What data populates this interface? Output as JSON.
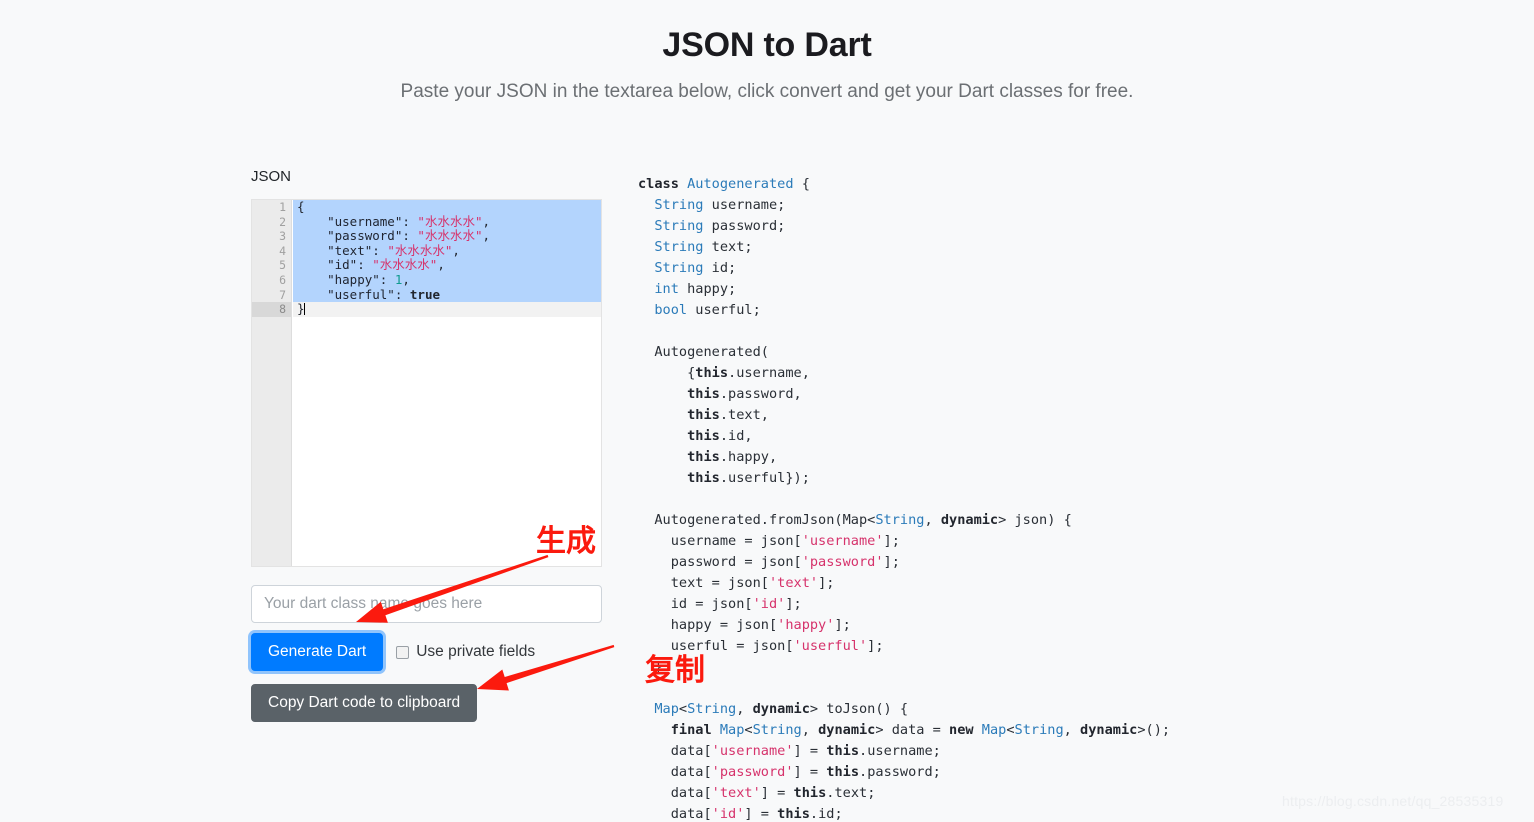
{
  "header": {
    "title": "JSON to Dart",
    "subtitle": "Paste your JSON in the textarea below, click convert and get your Dart classes for free."
  },
  "editor": {
    "label": "JSON",
    "line_numbers": [
      "1",
      "2",
      "3",
      "4",
      "5",
      "6",
      "7",
      "8"
    ],
    "fold_glyph": "▾",
    "active_line": 8,
    "lines": [
      {
        "n": 1,
        "selected": true,
        "tokens": [
          {
            "t": "punc",
            "v": "{"
          }
        ]
      },
      {
        "n": 2,
        "selected": true,
        "tokens": [
          {
            "t": "key",
            "v": "    \"username\": "
          },
          {
            "t": "str",
            "v": "\"水水水水\""
          },
          {
            "t": "punc",
            "v": ","
          }
        ]
      },
      {
        "n": 3,
        "selected": true,
        "tokens": [
          {
            "t": "key",
            "v": "    \"password\": "
          },
          {
            "t": "str",
            "v": "\"水水水水\""
          },
          {
            "t": "punc",
            "v": ","
          }
        ]
      },
      {
        "n": 4,
        "selected": true,
        "tokens": [
          {
            "t": "key",
            "v": "    \"text\": "
          },
          {
            "t": "str",
            "v": "\"水水水水\""
          },
          {
            "t": "punc",
            "v": ","
          }
        ]
      },
      {
        "n": 5,
        "selected": true,
        "tokens": [
          {
            "t": "key",
            "v": "    \"id\": "
          },
          {
            "t": "str",
            "v": "\"水水水水\""
          },
          {
            "t": "punc",
            "v": ","
          }
        ]
      },
      {
        "n": 6,
        "selected": true,
        "tokens": [
          {
            "t": "key",
            "v": "    \"happy\": "
          },
          {
            "t": "num",
            "v": "1"
          },
          {
            "t": "punc",
            "v": ","
          }
        ]
      },
      {
        "n": 7,
        "selected": true,
        "tokens": [
          {
            "t": "key",
            "v": "    \"userful\": "
          },
          {
            "t": "bool",
            "v": "true"
          }
        ]
      },
      {
        "n": 8,
        "selected": false,
        "current": true,
        "tokens": [
          {
            "t": "punc",
            "v": "}"
          }
        ]
      }
    ]
  },
  "form": {
    "class_name_value": "",
    "class_name_placeholder": "Your dart class name goes here",
    "generate_label": "Generate Dart",
    "private_fields_label": "Use private fields",
    "private_fields_checked": false,
    "copy_label": "Copy Dart code to clipboard"
  },
  "dart_output": {
    "lines": [
      [
        {
          "t": "kw",
          "v": "class "
        },
        {
          "t": "plain",
          "v": ""
        },
        {
          "t": "type",
          "v": "Autogenerated"
        },
        {
          "t": "plain",
          "v": " {"
        }
      ],
      [
        {
          "t": "type",
          "v": "  String"
        },
        {
          "t": "plain",
          "v": " username;"
        }
      ],
      [
        {
          "t": "type",
          "v": "  String"
        },
        {
          "t": "plain",
          "v": " password;"
        }
      ],
      [
        {
          "t": "type",
          "v": "  String"
        },
        {
          "t": "plain",
          "v": " text;"
        }
      ],
      [
        {
          "t": "type",
          "v": "  String"
        },
        {
          "t": "plain",
          "v": " id;"
        }
      ],
      [
        {
          "t": "type",
          "v": "  int"
        },
        {
          "t": "plain",
          "v": " happy;"
        }
      ],
      [
        {
          "t": "type",
          "v": "  bool"
        },
        {
          "t": "plain",
          "v": " userful;"
        }
      ],
      [
        {
          "t": "plain",
          "v": ""
        }
      ],
      [
        {
          "t": "plain",
          "v": "  Autogenerated("
        }
      ],
      [
        {
          "t": "plain",
          "v": "      {"
        },
        {
          "t": "kw",
          "v": "this"
        },
        {
          "t": "plain",
          "v": ".username,"
        }
      ],
      [
        {
          "t": "plain",
          "v": "      "
        },
        {
          "t": "kw",
          "v": "this"
        },
        {
          "t": "plain",
          "v": ".password,"
        }
      ],
      [
        {
          "t": "plain",
          "v": "      "
        },
        {
          "t": "kw",
          "v": "this"
        },
        {
          "t": "plain",
          "v": ".text,"
        }
      ],
      [
        {
          "t": "plain",
          "v": "      "
        },
        {
          "t": "kw",
          "v": "this"
        },
        {
          "t": "plain",
          "v": ".id,"
        }
      ],
      [
        {
          "t": "plain",
          "v": "      "
        },
        {
          "t": "kw",
          "v": "this"
        },
        {
          "t": "plain",
          "v": ".happy,"
        }
      ],
      [
        {
          "t": "plain",
          "v": "      "
        },
        {
          "t": "kw",
          "v": "this"
        },
        {
          "t": "plain",
          "v": ".userful});"
        }
      ],
      [
        {
          "t": "plain",
          "v": ""
        }
      ],
      [
        {
          "t": "plain",
          "v": "  Autogenerated.fromJson(Map<"
        },
        {
          "t": "type",
          "v": "String"
        },
        {
          "t": "plain",
          "v": ", "
        },
        {
          "t": "kw",
          "v": "dynamic"
        },
        {
          "t": "plain",
          "v": "> json) {"
        }
      ],
      [
        {
          "t": "plain",
          "v": "    username = json["
        },
        {
          "t": "str",
          "v": "'username'"
        },
        {
          "t": "plain",
          "v": "];"
        }
      ],
      [
        {
          "t": "plain",
          "v": "    password = json["
        },
        {
          "t": "str",
          "v": "'password'"
        },
        {
          "t": "plain",
          "v": "];"
        }
      ],
      [
        {
          "t": "plain",
          "v": "    text = json["
        },
        {
          "t": "str",
          "v": "'text'"
        },
        {
          "t": "plain",
          "v": "];"
        }
      ],
      [
        {
          "t": "plain",
          "v": "    id = json["
        },
        {
          "t": "str",
          "v": "'id'"
        },
        {
          "t": "plain",
          "v": "];"
        }
      ],
      [
        {
          "t": "plain",
          "v": "    happy = json["
        },
        {
          "t": "str",
          "v": "'happy'"
        },
        {
          "t": "plain",
          "v": "];"
        }
      ],
      [
        {
          "t": "plain",
          "v": "    userful = json["
        },
        {
          "t": "str",
          "v": "'userful'"
        },
        {
          "t": "plain",
          "v": "];"
        }
      ],
      [
        {
          "t": "plain",
          "v": "  }"
        }
      ],
      [
        {
          "t": "plain",
          "v": ""
        }
      ],
      [
        {
          "t": "type",
          "v": "  Map"
        },
        {
          "t": "plain",
          "v": "<"
        },
        {
          "t": "type",
          "v": "String"
        },
        {
          "t": "plain",
          "v": ", "
        },
        {
          "t": "kw",
          "v": "dynamic"
        },
        {
          "t": "plain",
          "v": "> toJson() {"
        }
      ],
      [
        {
          "t": "kw",
          "v": "    final "
        },
        {
          "t": "type",
          "v": "Map"
        },
        {
          "t": "plain",
          "v": "<"
        },
        {
          "t": "type",
          "v": "String"
        },
        {
          "t": "plain",
          "v": ", "
        },
        {
          "t": "kw",
          "v": "dynamic"
        },
        {
          "t": "plain",
          "v": "> data = "
        },
        {
          "t": "kw",
          "v": "new "
        },
        {
          "t": "type",
          "v": "Map"
        },
        {
          "t": "plain",
          "v": "<"
        },
        {
          "t": "type",
          "v": "String"
        },
        {
          "t": "plain",
          "v": ", "
        },
        {
          "t": "kw",
          "v": "dynamic"
        },
        {
          "t": "plain",
          "v": ">();"
        }
      ],
      [
        {
          "t": "plain",
          "v": "    data["
        },
        {
          "t": "str",
          "v": "'username'"
        },
        {
          "t": "plain",
          "v": "] = "
        },
        {
          "t": "kw",
          "v": "this"
        },
        {
          "t": "plain",
          "v": ".username;"
        }
      ],
      [
        {
          "t": "plain",
          "v": "    data["
        },
        {
          "t": "str",
          "v": "'password'"
        },
        {
          "t": "plain",
          "v": "] = "
        },
        {
          "t": "kw",
          "v": "this"
        },
        {
          "t": "plain",
          "v": ".password;"
        }
      ],
      [
        {
          "t": "plain",
          "v": "    data["
        },
        {
          "t": "str",
          "v": "'text'"
        },
        {
          "t": "plain",
          "v": "] = "
        },
        {
          "t": "kw",
          "v": "this"
        },
        {
          "t": "plain",
          "v": ".text;"
        }
      ],
      [
        {
          "t": "plain",
          "v": "    data["
        },
        {
          "t": "str",
          "v": "'id'"
        },
        {
          "t": "plain",
          "v": "] = "
        },
        {
          "t": "kw",
          "v": "this"
        },
        {
          "t": "plain",
          "v": ".id;"
        }
      ]
    ]
  },
  "annotations": {
    "generate_note": "生成",
    "copy_note": "复制",
    "arrow_color": "#fb1a0e"
  },
  "watermark": "https://blog.csdn.net/qq_28535319",
  "colors": {
    "primary": "#007bff",
    "secondary": "#5a6268",
    "selection": "#b3d4fd",
    "page_bg": "#f8f9fa",
    "annotation_red": "#fb1a0e"
  }
}
